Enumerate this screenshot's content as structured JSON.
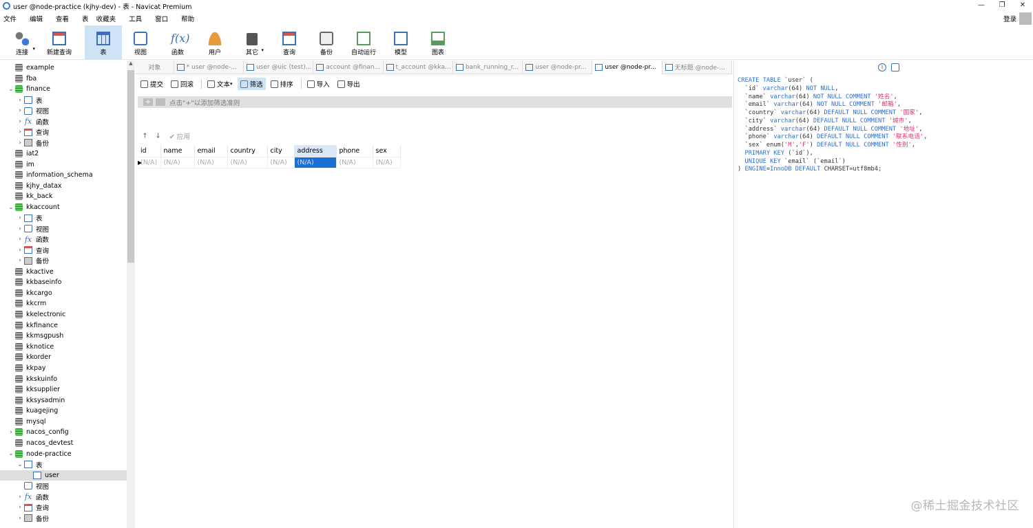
{
  "window": {
    "title": "user @node-practice (kjhy-dev) - 表 - Navicat Premium",
    "controls": [
      "—",
      "❐",
      "✕"
    ]
  },
  "menu": [
    "文件",
    "编辑",
    "查看",
    "表",
    "收藏夹",
    "工具",
    "窗口",
    "帮助"
  ],
  "login": "登录",
  "toolbar": [
    {
      "label": "连接",
      "icon": "connection-icon",
      "caret": true
    },
    {
      "label": "新建查询",
      "icon": "new-query-icon"
    },
    {
      "label": "表",
      "icon": "table-icon",
      "active": true
    },
    {
      "label": "视图",
      "icon": "view-icon"
    },
    {
      "label": "函数",
      "icon": "function-icon"
    },
    {
      "label": "用户",
      "icon": "user-icon"
    },
    {
      "label": "其它",
      "icon": "tools-icon",
      "caret": true
    },
    {
      "label": "查询",
      "icon": "query-icon"
    },
    {
      "label": "备份",
      "icon": "backup-icon"
    },
    {
      "label": "自动运行",
      "icon": "auto-run-icon"
    },
    {
      "label": "模型",
      "icon": "model-icon"
    },
    {
      "label": "图表",
      "icon": "chart-icon"
    }
  ],
  "tree": [
    {
      "label": "example",
      "level": 0,
      "type": "db"
    },
    {
      "label": "fba",
      "level": 0,
      "type": "db"
    },
    {
      "label": "finance",
      "level": 0,
      "type": "db-open",
      "tw": "⌄"
    },
    {
      "label": "表",
      "level": 1,
      "type": "table",
      "tw": "›"
    },
    {
      "label": "视图",
      "level": 1,
      "type": "view",
      "tw": "›"
    },
    {
      "label": "函数",
      "level": 1,
      "type": "func",
      "tw": "›"
    },
    {
      "label": "查询",
      "level": 1,
      "type": "query",
      "tw": "›"
    },
    {
      "label": "备份",
      "level": 1,
      "type": "backup",
      "tw": "›"
    },
    {
      "label": "iat2",
      "level": 0,
      "type": "db"
    },
    {
      "label": "im",
      "level": 0,
      "type": "db"
    },
    {
      "label": "information_schema",
      "level": 0,
      "type": "db"
    },
    {
      "label": "kjhy_datax",
      "level": 0,
      "type": "db"
    },
    {
      "label": "kk_back",
      "level": 0,
      "type": "db"
    },
    {
      "label": "kkaccount",
      "level": 0,
      "type": "db-open",
      "tw": "⌄"
    },
    {
      "label": "表",
      "level": 1,
      "type": "table",
      "tw": "›"
    },
    {
      "label": "视图",
      "level": 1,
      "type": "view",
      "tw": "›"
    },
    {
      "label": "函数",
      "level": 1,
      "type": "func",
      "tw": "›"
    },
    {
      "label": "查询",
      "level": 1,
      "type": "query",
      "tw": "›"
    },
    {
      "label": "备份",
      "level": 1,
      "type": "backup",
      "tw": "›"
    },
    {
      "label": "kkactive",
      "level": 0,
      "type": "db"
    },
    {
      "label": "kkbaseinfo",
      "level": 0,
      "type": "db"
    },
    {
      "label": "kkcargo",
      "level": 0,
      "type": "db"
    },
    {
      "label": "kkcrm",
      "level": 0,
      "type": "db"
    },
    {
      "label": "kkelectronic",
      "level": 0,
      "type": "db"
    },
    {
      "label": "kkfinance",
      "level": 0,
      "type": "db"
    },
    {
      "label": "kkmsgpush",
      "level": 0,
      "type": "db"
    },
    {
      "label": "kknotice",
      "level": 0,
      "type": "db"
    },
    {
      "label": "kkorder",
      "level": 0,
      "type": "db"
    },
    {
      "label": "kkpay",
      "level": 0,
      "type": "db"
    },
    {
      "label": "kkskuinfo",
      "level": 0,
      "type": "db"
    },
    {
      "label": "kksupplier",
      "level": 0,
      "type": "db"
    },
    {
      "label": "kksysadmin",
      "level": 0,
      "type": "db"
    },
    {
      "label": "kuagejing",
      "level": 0,
      "type": "db"
    },
    {
      "label": "mysql",
      "level": 0,
      "type": "db"
    },
    {
      "label": "nacos_config",
      "level": 0,
      "type": "db-open-closed",
      "tw": "›"
    },
    {
      "label": "nacos_devtest",
      "level": 0,
      "type": "db"
    },
    {
      "label": "node-practice",
      "level": 0,
      "type": "db-open",
      "tw": "⌄"
    },
    {
      "label": "表",
      "level": 1,
      "type": "table",
      "tw": "⌄"
    },
    {
      "label": "user",
      "level": 2,
      "type": "table",
      "selected": true
    },
    {
      "label": "视图",
      "level": 1,
      "type": "view"
    },
    {
      "label": "函数",
      "level": 1,
      "type": "func",
      "tw": "›"
    },
    {
      "label": "查询",
      "level": 1,
      "type": "query",
      "tw": "›"
    },
    {
      "label": "备份",
      "level": 1,
      "type": "backup",
      "tw": "›"
    }
  ],
  "tabs": [
    {
      "label": "对象",
      "first": true
    },
    {
      "label": "* user @node-..."
    },
    {
      "label": "user @uic (test)..."
    },
    {
      "label": "account @finan..."
    },
    {
      "label": "t_account @kka..."
    },
    {
      "label": "bank_running_r..."
    },
    {
      "label": "user @node-pr..."
    },
    {
      "label": "user @node-pr...",
      "active": true
    },
    {
      "label": "无标题 @node-..."
    }
  ],
  "subtoolbar": [
    {
      "label": "提交",
      "icon": "commit-icon"
    },
    {
      "label": "回滚",
      "icon": "rollback-icon"
    },
    {
      "label": "文本",
      "icon": "text-icon",
      "caret": true
    },
    {
      "label": "筛选",
      "icon": "filter-icon",
      "active": true
    },
    {
      "label": "排序",
      "icon": "sort-icon"
    },
    {
      "label": "导入",
      "icon": "import-icon"
    },
    {
      "label": "导出",
      "icon": "export-icon"
    }
  ],
  "filter": {
    "plus": "+",
    "hint": "点击\"+\"以添加筛选准则"
  },
  "sort": {
    "up": "🡑",
    "down": "🡓",
    "apply": "✔ 应用"
  },
  "grid": {
    "columns": [
      "id",
      "name",
      "email",
      "country",
      "city",
      "address",
      "phone",
      "sex"
    ],
    "highlight_column": "address",
    "rows": [
      [
        "(N/A)",
        "(N/A)",
        "(N/A)",
        "(N/A)",
        "(N/A)",
        "(N/A)",
        "(N/A)",
        "(N/A)"
      ]
    ],
    "selected_cell": "address"
  },
  "ddl": [
    [
      [
        "kw",
        "CREATE TABLE "
      ],
      [
        "",
        "`user` ("
      ]
    ],
    [
      [
        "",
        "  `id` "
      ],
      [
        "kw",
        "varchar"
      ],
      [
        "",
        "(64) "
      ],
      [
        "kw",
        "NOT NULL"
      ],
      [
        "",
        ","
      ]
    ],
    [
      [
        "",
        "  `name` "
      ],
      [
        "kw",
        "varchar"
      ],
      [
        "",
        "(64) "
      ],
      [
        "kw",
        "NOT NULL COMMENT "
      ],
      [
        "str",
        "'姓名'"
      ],
      [
        "",
        ","
      ]
    ],
    [
      [
        "",
        "  `email` "
      ],
      [
        "kw",
        "varchar"
      ],
      [
        "",
        "(64) "
      ],
      [
        "kw",
        "NOT NULL COMMENT "
      ],
      [
        "str",
        "'邮箱'"
      ],
      [
        "",
        ","
      ]
    ],
    [
      [
        "",
        "  `country` "
      ],
      [
        "kw",
        "varchar"
      ],
      [
        "",
        "(64) "
      ],
      [
        "kw",
        "DEFAULT NULL COMMENT "
      ],
      [
        "str",
        "'国家'"
      ],
      [
        "",
        ","
      ]
    ],
    [
      [
        "",
        "  `city` "
      ],
      [
        "kw",
        "varchar"
      ],
      [
        "",
        "(64) "
      ],
      [
        "kw",
        "DEFAULT NULL COMMENT "
      ],
      [
        "str",
        "'城市'"
      ],
      [
        "",
        ","
      ]
    ],
    [
      [
        "",
        "  `address` "
      ],
      [
        "kw",
        "varchar"
      ],
      [
        "",
        "(64) "
      ],
      [
        "kw",
        "DEFAULT NULL COMMENT "
      ],
      [
        "str",
        "'地址'"
      ],
      [
        "",
        ","
      ]
    ],
    [
      [
        "",
        "  `phone` "
      ],
      [
        "kw",
        "varchar"
      ],
      [
        "",
        "(64) "
      ],
      [
        "kw",
        "DEFAULT NULL COMMENT "
      ],
      [
        "str",
        "'联系电话'"
      ],
      [
        "",
        ","
      ]
    ],
    [
      [
        "",
        "  `sex` enum("
      ],
      [
        "str",
        "'M'"
      ],
      [
        "",
        ","
      ],
      [
        "str",
        "'F'"
      ],
      [
        "",
        ") "
      ],
      [
        "kw",
        "DEFAULT NULL COMMENT "
      ],
      [
        "str",
        "'性别'"
      ],
      [
        "",
        ","
      ]
    ],
    [
      [
        "kw",
        "  PRIMARY KEY "
      ],
      [
        "",
        "(`id`),"
      ]
    ],
    [
      [
        "kw",
        "  UNIQUE KEY "
      ],
      [
        "",
        "`email` (`email`)"
      ]
    ],
    [
      [
        "",
        ") "
      ],
      [
        "kw",
        "ENGINE"
      ],
      [
        "",
        "="
      ],
      [
        "kw",
        "InnoDB DEFAULT "
      ],
      [
        "",
        "CHARSET=utf8mb4;"
      ]
    ]
  ],
  "watermark": "@稀土掘金技术社区"
}
